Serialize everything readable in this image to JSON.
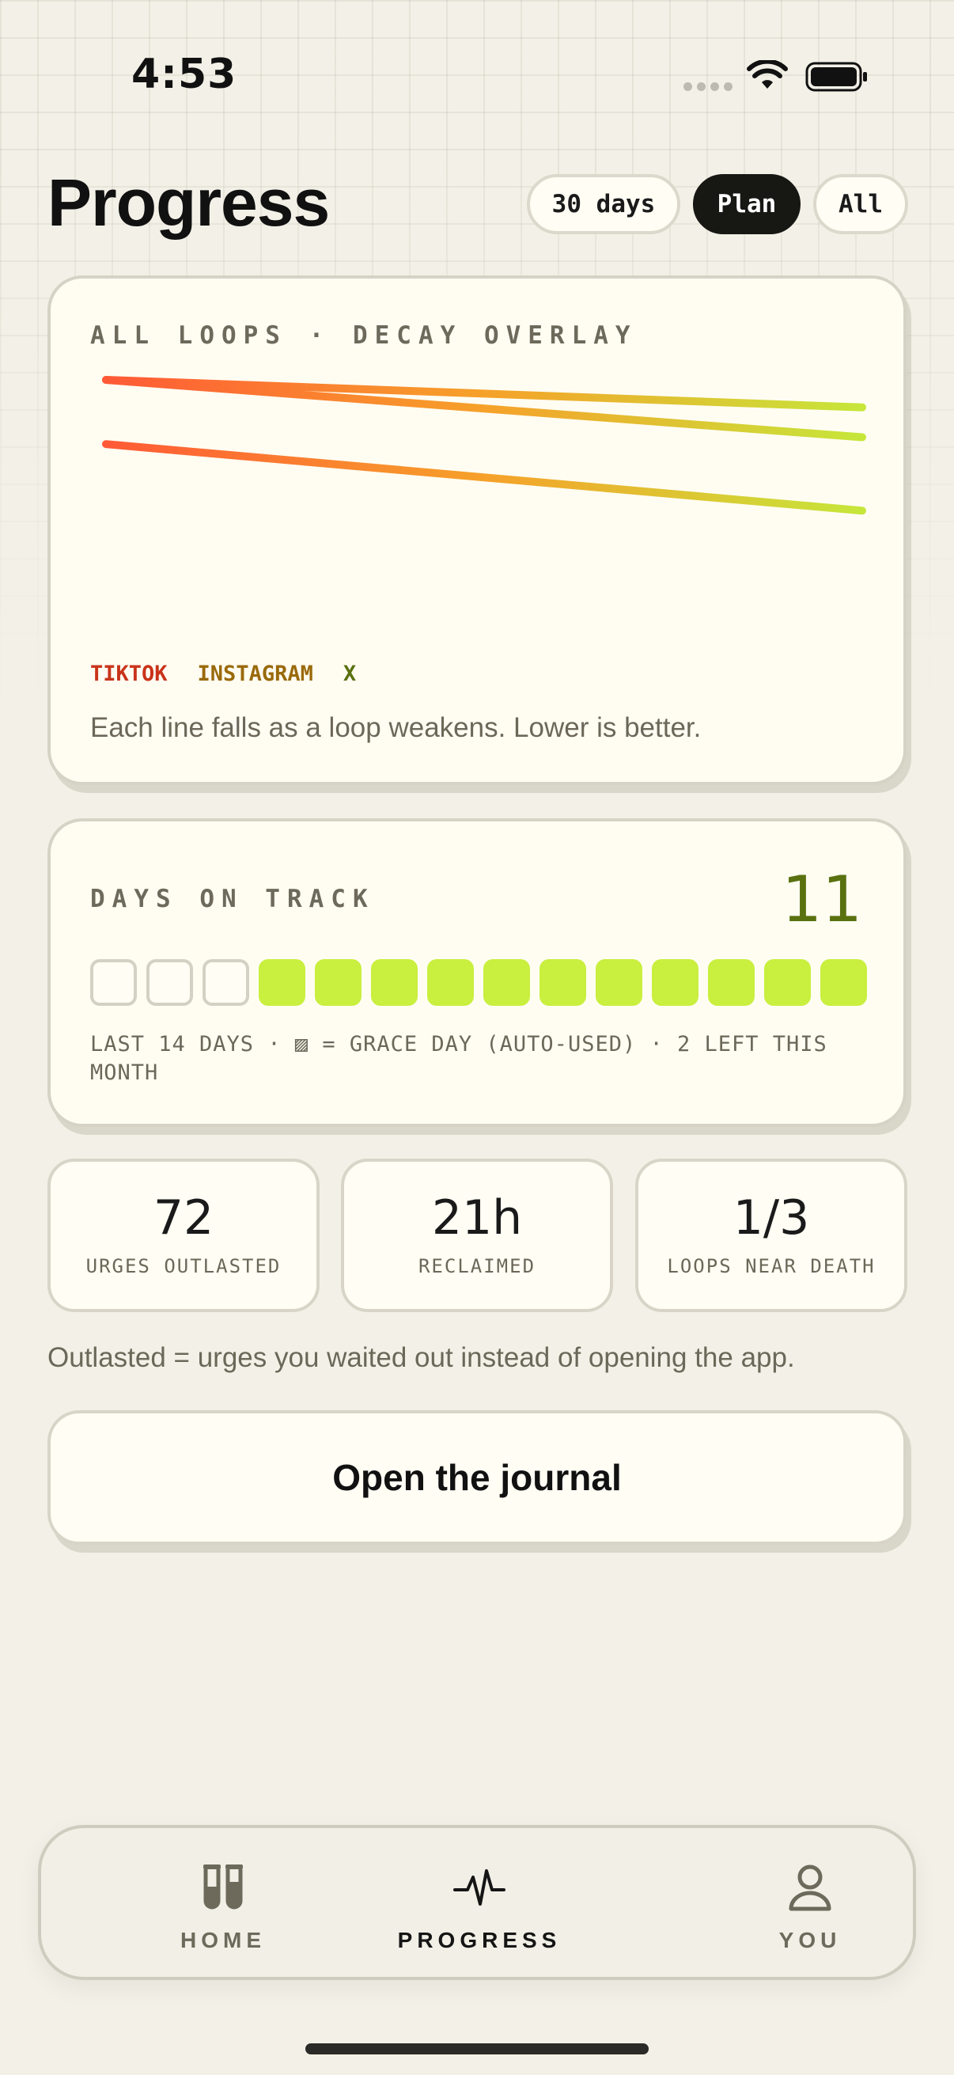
{
  "status_bar": {
    "time": "4:53"
  },
  "header": {
    "title": "Progress",
    "filters": [
      {
        "label": "30 days",
        "selected": false
      },
      {
        "label": "Plan",
        "selected": true
      },
      {
        "label": "All",
        "selected": false
      }
    ]
  },
  "decay_card": {
    "title": "ALL LOOPS · DECAY OVERLAY",
    "legend": [
      {
        "label": "TIKTOK",
        "color": "#c9341a"
      },
      {
        "label": "INSTAGRAM",
        "color": "#9a6a0a"
      },
      {
        "label": "X",
        "color": "#5a7110"
      }
    ],
    "caption": "Each line falls as a loop weakens. Lower is better.",
    "gradient": {
      "start": "#ff5a36",
      "mid": "#f6a12a",
      "end": "#c6e63a"
    }
  },
  "chart_data": {
    "type": "line",
    "title": "ALL LOOPS · DECAY OVERLAY",
    "series": [
      {
        "name": "TIKTOK",
        "values": [
          1.0,
          0.75
        ],
        "color": "#c9341a"
      },
      {
        "name": "INSTAGRAM",
        "values": [
          1.0,
          0.88
        ],
        "color": "#9a6a0a"
      },
      {
        "name": "X",
        "values": [
          0.72,
          0.43
        ],
        "color": "#5a7110"
      }
    ],
    "x": [
      0,
      1
    ],
    "ylim": [
      0,
      1
    ],
    "grid": false,
    "legend_position": "bottom-left"
  },
  "track_card": {
    "title": "DAYS ON TRACK",
    "count": "11",
    "days": [
      "empty",
      "empty",
      "empty",
      "on",
      "on",
      "on",
      "on",
      "on",
      "on",
      "on",
      "on",
      "on",
      "on",
      "on"
    ],
    "note": "LAST 14 DAYS · ▨ = GRACE DAY (AUTO-USED) · 2 LEFT THIS MONTH",
    "on_color": "#c9ef3f"
  },
  "stats": [
    {
      "value": "72",
      "label": "URGES OUTLASTED"
    },
    {
      "value": "21h",
      "label": "RECLAIMED"
    },
    {
      "value": "1/3",
      "label": "LOOPS NEAR DEATH"
    }
  ],
  "explain": "Outlasted = urges you waited out instead of opening the app.",
  "journal_button": "Open the journal",
  "tabs": [
    {
      "label": "HOME",
      "icon": "test-tubes-icon",
      "active": false
    },
    {
      "label": "PROGRESS",
      "icon": "pulse-icon",
      "active": true
    },
    {
      "label": "YOU",
      "icon": "person-icon",
      "active": false
    }
  ]
}
